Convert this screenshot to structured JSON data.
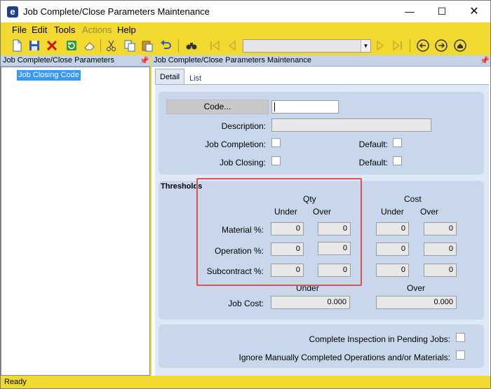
{
  "window": {
    "title": "Job Complete/Close Parameters Maintenance",
    "icon_letter": "e"
  },
  "menu": [
    "File",
    "Edit",
    "Tools",
    "Actions",
    "Help"
  ],
  "left_pane": {
    "title": "Job Complete/Close Parameters",
    "tree_item": "Job Closing Code"
  },
  "right_pane": {
    "title": "Job Complete/Close Parameters Maintenance"
  },
  "tabs": {
    "detail": "Detail",
    "list": "List"
  },
  "form": {
    "code_button": "Code...",
    "code_value": "",
    "description_label": "Description:",
    "description_value": "",
    "job_completion_label": "Job Completion:",
    "job_closing_label": "Job Closing:",
    "default_label": "Default:"
  },
  "thresholds": {
    "title": "Thresholds",
    "qty_label": "Qty",
    "cost_label": "Cost",
    "under_label": "Under",
    "over_label": "Over",
    "rows": [
      {
        "label": "Material %:",
        "qty_under": "0",
        "qty_over": "0",
        "cost_under": "0",
        "cost_over": "0"
      },
      {
        "label": "Operation %:",
        "qty_under": "0",
        "qty_over": "0",
        "cost_under": "0",
        "cost_over": "0"
      },
      {
        "label": "Subcontract %:",
        "qty_under": "0",
        "qty_over": "0",
        "cost_under": "0",
        "cost_over": "0"
      }
    ],
    "job_cost_label": "Job Cost:",
    "job_cost_under_header": "Under",
    "job_cost_over_header": "Over",
    "job_cost_under": "0.000",
    "job_cost_over": "0.000"
  },
  "options": {
    "complete_inspection": "Complete Inspection in Pending Jobs:",
    "ignore_manual": "Ignore Manually Completed Operations and/or Materials:"
  },
  "status": "Ready",
  "colors": {
    "chrome": "#f2d92f",
    "panel": "#c9d7ec",
    "highlight": "#e05050",
    "selection": "#3399ff"
  }
}
